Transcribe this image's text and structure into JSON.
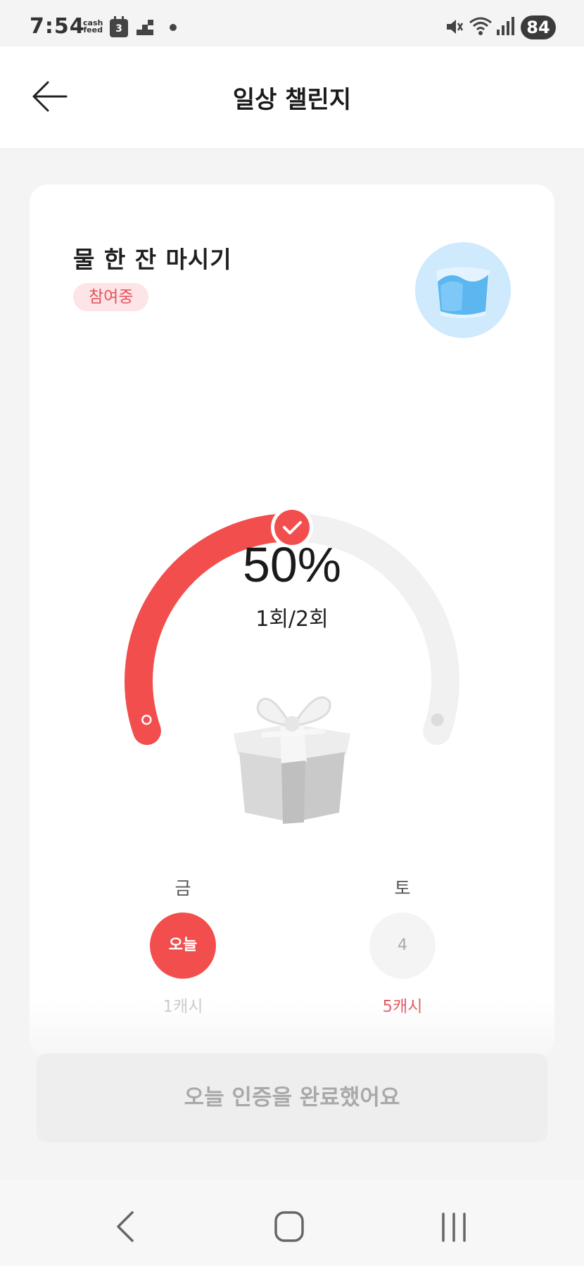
{
  "status_bar": {
    "time": "7:54",
    "cashfeed_line1": "cash",
    "cashfeed_line2": "feed",
    "calendar_day": "3",
    "battery": "84"
  },
  "header": {
    "title": "일상 챌린지"
  },
  "challenge": {
    "title": "물 한 잔 마시기",
    "status": "참여중",
    "progress_fraction": 0.5,
    "percent_label": "50%",
    "count_label": "1회/2회"
  },
  "days": [
    {
      "weekday": "금",
      "circle_label": "오늘",
      "reward": "1캐시"
    },
    {
      "weekday": "토",
      "circle_label": "4",
      "reward": "5캐시"
    }
  ],
  "action": {
    "label": "오늘 인증을 완료했어요"
  },
  "colors": {
    "accent": "#f24e4e",
    "track": "#f1f1f1",
    "badge_bg": "#fde4e6",
    "badge_text": "#e8515a",
    "water_bg": "#cfe9fd"
  },
  "icons": {
    "back": "arrow-left-icon",
    "water": "water-glass-icon",
    "gift": "gift-box-icon",
    "check": "check-icon"
  }
}
